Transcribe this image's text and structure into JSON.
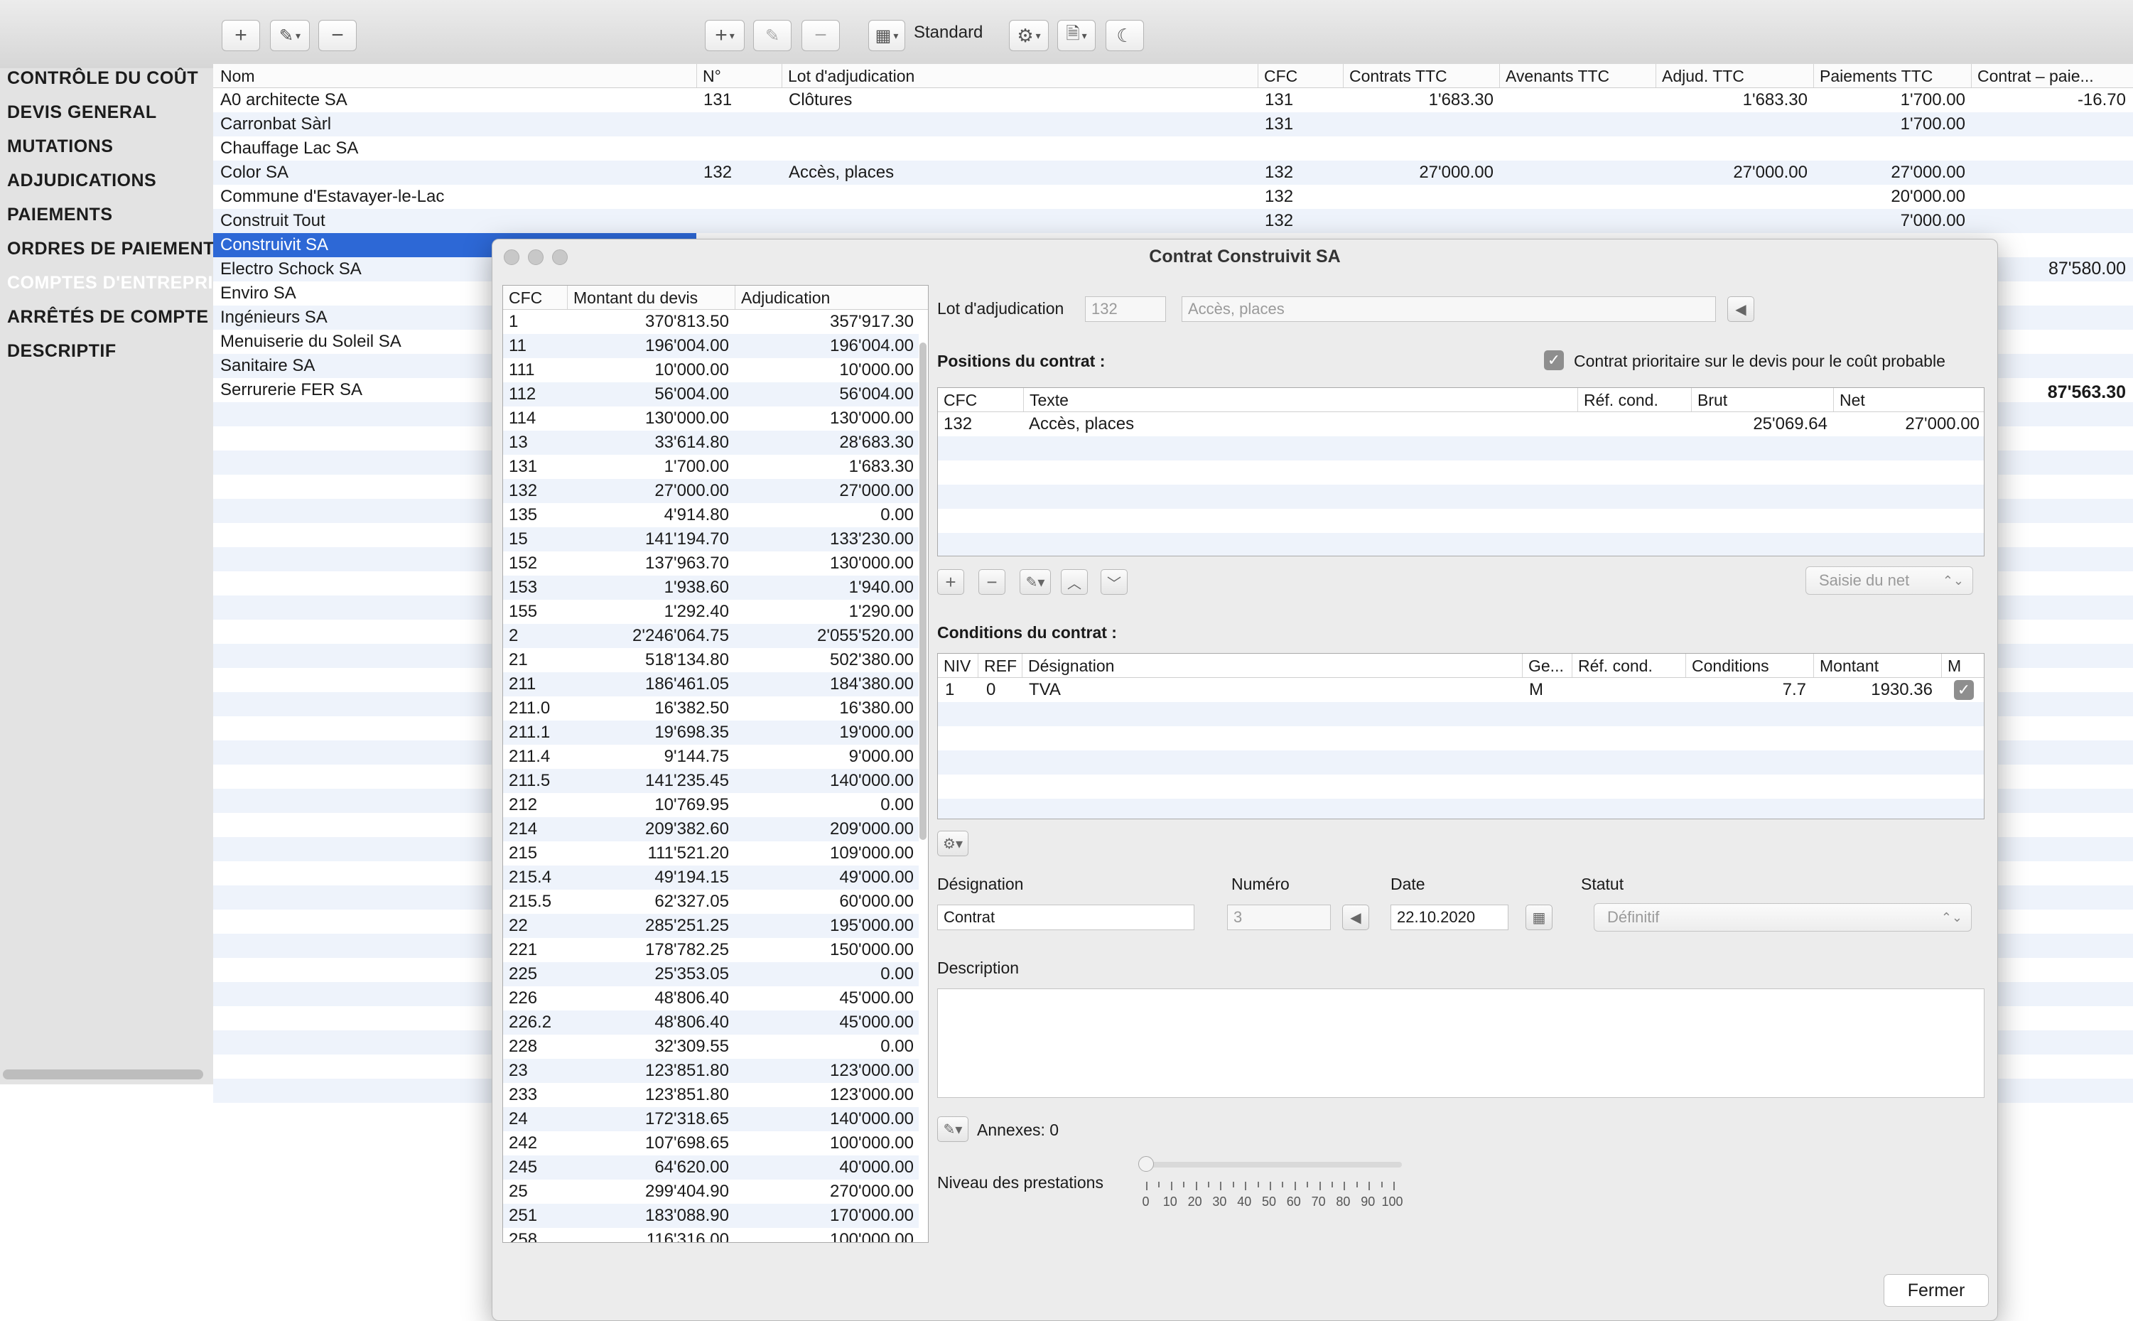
{
  "toolbar": {
    "left_buttons": [
      "plus-icon",
      "pencil-icon",
      "minus-icon"
    ],
    "view_label": "Standard"
  },
  "sidebar": {
    "items": [
      {
        "label": "CONTRÔLE DU COÛT"
      },
      {
        "label": "DEVIS GENERAL"
      },
      {
        "label": "MUTATIONS"
      },
      {
        "label": "ADJUDICATIONS"
      },
      {
        "label": "PAIEMENTS"
      },
      {
        "label": "ORDRES DE PAIEMENT"
      },
      {
        "label": "COMPTES D'ENTREPRISE"
      },
      {
        "label": "ARRÊTÉS DE COMPTE"
      },
      {
        "label": "DESCRIPTIF"
      }
    ]
  },
  "companies": {
    "header": "Nom",
    "items": [
      "A0 architecte SA",
      "Carronbat Sàrl",
      "Chauffage Lac SA",
      "Color SA",
      "Commune d'Estavayer-le-Lac",
      "Construit Tout",
      "Construivit SA",
      "Electro Schock SA",
      "Enviro SA",
      "Ingénieurs SA",
      "Menuiserie du Soleil SA",
      "Sanitaire SA",
      "Serrurerie FER SA"
    ]
  },
  "grid": {
    "headers": [
      "N°",
      "Lot d'adjudication",
      "CFC",
      "Contrats TTC",
      "Avenants TTC",
      "Adjud. TTC",
      "Paiements TTC",
      "Contrat – paie..."
    ],
    "rows": [
      {
        "no": "131",
        "lot": "Clôtures",
        "cfc": "131",
        "contrats": "1'683.30",
        "adjud": "1'683.30",
        "paiements": "1'700.00",
        "diff": "-16.70"
      },
      {
        "no": "",
        "lot": "",
        "cfc": "131",
        "contrats": "",
        "adjud": "",
        "paiements": "1'700.00",
        "diff": ""
      },
      {
        "no": "",
        "lot": "",
        "cfc": "",
        "contrats": "",
        "adjud": "",
        "paiements": "",
        "diff": ""
      },
      {
        "no": "132",
        "lot": "Accès, places",
        "cfc": "132",
        "contrats": "27'000.00",
        "adjud": "27'000.00",
        "paiements": "27'000.00",
        "diff": ""
      },
      {
        "no": "",
        "lot": "",
        "cfc": "132",
        "contrats": "",
        "adjud": "",
        "paiements": "20'000.00",
        "diff": ""
      },
      {
        "no": "",
        "lot": "",
        "cfc": "132",
        "contrats": "",
        "adjud": "",
        "paiements": "7'000.00",
        "diff": ""
      }
    ],
    "side_total_1": "87'580.00",
    "side_total_2": "87'563.30"
  },
  "dialog": {
    "title": "Contrat Construivit SA",
    "cfc_table": {
      "headers": [
        "CFC",
        "Montant du devis",
        "Adjudication"
      ],
      "rows": [
        [
          "1",
          "370'813.50",
          "357'917.30"
        ],
        [
          "11",
          "196'004.00",
          "196'004.00"
        ],
        [
          "111",
          "10'000.00",
          "10'000.00"
        ],
        [
          "112",
          "56'004.00",
          "56'004.00"
        ],
        [
          "114",
          "130'000.00",
          "130'000.00"
        ],
        [
          "13",
          "33'614.80",
          "28'683.30"
        ],
        [
          "131",
          "1'700.00",
          "1'683.30"
        ],
        [
          "132",
          "27'000.00",
          "27'000.00"
        ],
        [
          "135",
          "4'914.80",
          "0.00"
        ],
        [
          "15",
          "141'194.70",
          "133'230.00"
        ],
        [
          "152",
          "137'963.70",
          "130'000.00"
        ],
        [
          "153",
          "1'938.60",
          "1'940.00"
        ],
        [
          "155",
          "1'292.40",
          "1'290.00"
        ],
        [
          "2",
          "2'246'064.75",
          "2'055'520.00"
        ],
        [
          "21",
          "518'134.80",
          "502'380.00"
        ],
        [
          "211",
          "186'461.05",
          "184'380.00"
        ],
        [
          "211.0",
          "16'382.50",
          "16'380.00"
        ],
        [
          "211.1",
          "19'698.35",
          "19'000.00"
        ],
        [
          "211.4",
          "9'144.75",
          "9'000.00"
        ],
        [
          "211.5",
          "141'235.45",
          "140'000.00"
        ],
        [
          "212",
          "10'769.95",
          "0.00"
        ],
        [
          "214",
          "209'382.60",
          "209'000.00"
        ],
        [
          "215",
          "111'521.20",
          "109'000.00"
        ],
        [
          "215.4",
          "49'194.15",
          "49'000.00"
        ],
        [
          "215.5",
          "62'327.05",
          "60'000.00"
        ],
        [
          "22",
          "285'251.25",
          "195'000.00"
        ],
        [
          "221",
          "178'782.25",
          "150'000.00"
        ],
        [
          "225",
          "25'353.05",
          "0.00"
        ],
        [
          "226",
          "48'806.40",
          "45'000.00"
        ],
        [
          "226.2",
          "48'806.40",
          "45'000.00"
        ],
        [
          "228",
          "32'309.55",
          "0.00"
        ],
        [
          "23",
          "123'851.80",
          "123'000.00"
        ],
        [
          "233",
          "123'851.80",
          "123'000.00"
        ],
        [
          "24",
          "172'318.65",
          "140'000.00"
        ],
        [
          "242",
          "107'698.65",
          "100'000.00"
        ],
        [
          "245",
          "64'620.00",
          "40'000.00"
        ],
        [
          "25",
          "299'404.90",
          "270'000.00"
        ],
        [
          "251",
          "183'088.90",
          "170'000.00"
        ],
        [
          "258",
          "116'316.00",
          "100'000.00"
        ]
      ]
    },
    "lot_label": "Lot d'adjudication",
    "lot_number": "132",
    "lot_name": "Accès, places",
    "positions_label": "Positions du contrat :",
    "priority_label": "Contrat prioritaire sur le devis pour le coût probable",
    "positions": {
      "headers": [
        "CFC",
        "Texte",
        "Réf. cond.",
        "Brut",
        "Net"
      ],
      "rows": [
        {
          "cfc": "132",
          "texte": "Accès, places",
          "ref": "",
          "brut": "25'069.64",
          "net": "27'000.00"
        }
      ]
    },
    "entry_mode": "Saisie du net",
    "conditions_label": "Conditions du contrat :",
    "conditions": {
      "headers": [
        "NIV",
        "REF",
        "Désignation",
        "Ge...",
        "Réf. cond.",
        "Conditions",
        "Montant",
        "M"
      ],
      "rows": [
        {
          "niv": "1",
          "ref": "0",
          "designation": "TVA",
          "ge": "M",
          "refcond": "",
          "conditions": "7.7",
          "montant": "1930.36",
          "m": true
        }
      ]
    },
    "designation_label": "Désignation",
    "designation_value": "Contrat",
    "numero_label": "Numéro",
    "numero_value": "3",
    "date_label": "Date",
    "date_value": "22.10.2020",
    "statut_label": "Statut",
    "statut_value": "Définitif",
    "description_label": "Description",
    "description_value": "",
    "annexes_label": "Annexes: 0",
    "niveau_label": "Niveau des prestations",
    "niveau_ticks": [
      "0",
      "10",
      "20",
      "30",
      "40",
      "50",
      "60",
      "70",
      "80",
      "90",
      "100"
    ],
    "niveau_value": 0,
    "close_label": "Fermer"
  },
  "colors": {
    "selection": "#2d68d6",
    "alt_row": "#eef3fb",
    "checkbox": "#8e8e8e"
  }
}
